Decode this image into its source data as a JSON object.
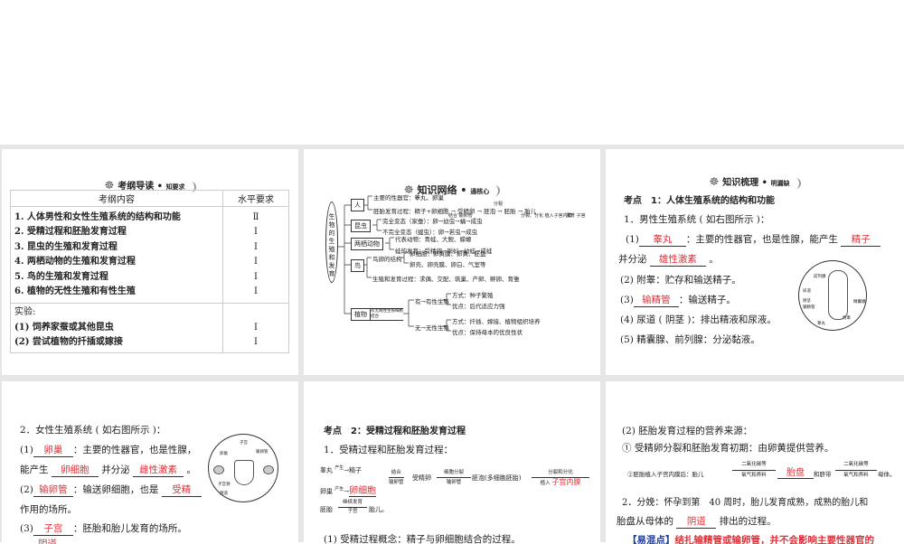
{
  "slide1": {
    "header": "考纲导读",
    "header_sub": "知要求",
    "col1": "考纲内容",
    "col2": "水平要求",
    "rows": [
      {
        "c": "1. 人体男性和女性生殖系统的结构和功能",
        "l": "Ⅱ"
      },
      {
        "c": "2. 受精过程和胚胎发育过程",
        "l": "Ⅰ"
      },
      {
        "c": "3. 昆虫的生殖和发育过程",
        "l": "Ⅰ"
      },
      {
        "c": "4. 两栖动物的生殖和发育过程",
        "l": "Ⅰ"
      },
      {
        "c": "5. 鸟的生殖和发育过程",
        "l": "Ⅰ"
      },
      {
        "c": "6. 植物的无性生殖和有性生殖",
        "l": "Ⅰ"
      }
    ],
    "exp_label": "实验:",
    "exp_rows": [
      {
        "c": "(1) 饲养家蚕或其他昆虫",
        "l": "Ⅰ"
      },
      {
        "c": "(2) 尝试植物的扦插或嫁接",
        "l": "Ⅰ"
      }
    ]
  },
  "slide2": {
    "header": "知识网络",
    "header_sub": "通核心",
    "root": "生物的生殖和发育",
    "nodes": {
      "ren": "人",
      "kunchong": "昆虫",
      "liangqi": "两栖动物",
      "niao": "鸟",
      "zhiwu": "植物"
    },
    "lines": {
      "r1": "主要的性器官：睾丸、卵巢",
      "r2": "胚胎发育过程：精子+卵细胞 → 受精卵 → 胚泡 → 胚胎 → 胎儿",
      "r2a": "结合 输卵管",
      "r2b": "分裂",
      "r2c": "分裂、分化 植入子宫内膜",
      "r2d": "发育 子宫",
      "k1": "完全变态（家蚕）：卵→幼虫→蛹→成虫",
      "k2": "不完全变态（蝗虫）：卵→若虫→成虫",
      "l1": "代表动物：青蛙、大鲵、蝾螈",
      "l2": "蛙的发育：受精卵→蝌蚪→幼蛙→成蛙",
      "n0": "鸟卵的结构",
      "n1": "卵细胞：卵黄膜、卵黄、胚盘",
      "n2": "卵壳、卵壳膜、卵白、气室等",
      "n3": "生殖和发育过程：求偶、交配、筑巢、产卵、孵卵、育雏",
      "z0": "有无两性生殖细胞结合",
      "z1": "有→有性生殖",
      "z2": "方式：种子繁殖",
      "z3": "优点：后代适应力强",
      "z4": "无→无性生殖",
      "z5": "方式：扦插、嫁接、植物组织培养",
      "z6": "优点：保持母本的优良性状"
    }
  },
  "slide3": {
    "header": "知识梳理",
    "header_sub": "明漏缺",
    "point": "考点　1：人体生殖系统的结构和功能",
    "sub1": "1．男性生殖系统 ( 如右图所示 )：",
    "l1a": "(1)",
    "b1": "睾丸",
    "l1b": "：主要的性器官，也是性腺，能产生",
    "b2": "精子",
    "l1c": "并分泌",
    "b3": "雄性激素",
    "l1d": "。",
    "l2": "(2) 附睾：贮存和输送精子。",
    "l3a": "(3)",
    "b4": "输精管",
    "l3b": "：输送精子。",
    "l4": "(4) 尿道 ( 阴茎 )：排出精液和尿液。",
    "l5": "(5) 精囊腺、前列腺：分泌黏液。",
    "diagram_labels": [
      "前列腺",
      "尿道",
      "阴茎",
      "输精管",
      "精囊腺",
      "附睾",
      "睾丸"
    ]
  },
  "slide4": {
    "sub2": "2．女性生殖系统 ( 如右图所示 )：",
    "l1a": "(1)",
    "b1": "卵巢",
    "l1b": "：主要的性器官，也是性腺，",
    "l2a": "能产生",
    "b2": "卵细胞",
    "l2b": "并分泌",
    "b3": "雌性激素",
    "l2c": "。",
    "l3a": "(2)",
    "b4": "输卵管",
    "l3b": "：输送卵细胞，也是",
    "b5": "受精",
    "l4": "作用的场所。",
    "l5a": "(3)",
    "b6": "子宫",
    "l5b": "：胚胎和胎儿发育的场所。",
    "b7": "阴道",
    "diagram_labels": [
      "子宫",
      "卵巢",
      "输卵管",
      "子宫颈",
      "阴道"
    ]
  },
  "slide5": {
    "point": "考点　2：受精过程和胚胎发育过程",
    "sub1": "1．受精过程和胚胎发育过程：",
    "f1": "睾丸",
    "f1a": "产生",
    "f1b": "精子",
    "f2": "卵巢",
    "f2a": "产生",
    "b1": "卵细胞",
    "j1": "结合",
    "j2": "输卵管",
    "f3": "受精卵",
    "j3": "细胞分裂",
    "j4": "输卵管",
    "f4": "胚泡(多细胞胚胎)",
    "j5": "分裂和分化",
    "j6": "植入",
    "b2": "子宫内膜",
    "g1": "胚胎",
    "g2": "继续发育",
    "g3": "子宫",
    "g4": "胎儿。",
    "c1": "(1) 受精过程概念：精子与卵细胞结合的过程。"
  },
  "slide6": {
    "l1": "(2) 胚胎发育过程的营养来源：",
    "l2": "① 受精卵分裂和胚胎发育初期：由卵黄提供营养。",
    "l3a": "②胚胎植入子宫内膜后：胎儿",
    "l3t": "二氧化碳等",
    "l3u": "氧气和养料",
    "b1": "胎盘",
    "l3b": "和脐带",
    "l3c": "母体。",
    "l4": "2．分娩：怀孕到第　40 周时，胎儿发育成熟，成熟的胎儿和",
    "l5a": "胎盘从母体的",
    "b2": "阴道",
    "l5b": "排出的过程。",
    "l6a": "【易混点】",
    "l6b": "结扎输精管或输卵管，并不会影响主要性器官的"
  }
}
